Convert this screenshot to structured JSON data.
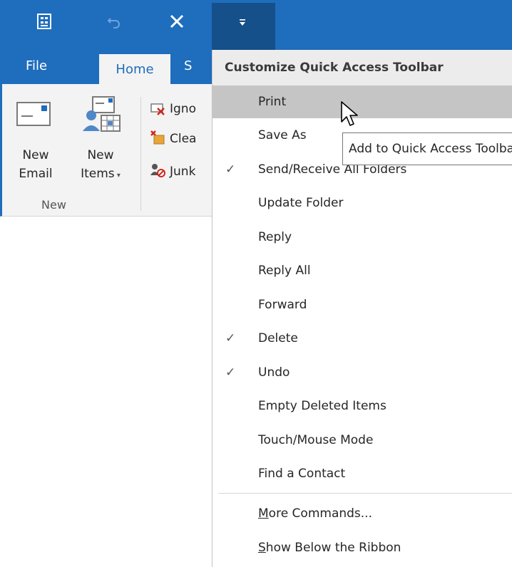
{
  "qat": {
    "buttons": [
      {
        "name": "send-receive-all-icon"
      },
      {
        "name": "undo-icon"
      },
      {
        "name": "delete-icon"
      },
      {
        "name": "customize-qat-dropdown-icon"
      }
    ]
  },
  "tabs": {
    "file": "File",
    "home": "Home",
    "next_partial": "S"
  },
  "ribbon": {
    "new_email": [
      "New",
      "Email"
    ],
    "new_items": [
      "New",
      "Items"
    ],
    "group_label": "New",
    "small_buttons": [
      {
        "label": "Igno",
        "icon": "ignore-icon"
      },
      {
        "label": "Clea",
        "icon": "clean-up-icon"
      },
      {
        "label": "Junk",
        "icon": "junk-icon"
      }
    ]
  },
  "menu": {
    "header": "Customize Quick Access Toolbar",
    "items": [
      {
        "label": "Print",
        "checked": false,
        "hover": true
      },
      {
        "label": "Save As",
        "checked": false
      },
      {
        "label": "Send/Receive All Folders",
        "checked": true
      },
      {
        "label": "Update Folder",
        "checked": false
      },
      {
        "label": "Reply",
        "checked": false
      },
      {
        "label": "Reply All",
        "checked": false
      },
      {
        "label": "Forward",
        "checked": false
      },
      {
        "label": "Delete",
        "checked": true
      },
      {
        "label": "Undo",
        "checked": true
      },
      {
        "label": "Empty Deleted Items",
        "checked": false
      },
      {
        "label": "Touch/Mouse Mode",
        "checked": false
      },
      {
        "label": "Find a Contact",
        "checked": false
      }
    ],
    "more_commands": "More Commands...",
    "more_commands_accel": "M",
    "more_commands_rest": "ore Commands...",
    "show_below": "Show Below the Ribbon",
    "show_below_accel": "S",
    "show_below_rest": "how Below the Ribbon"
  },
  "tooltip": "Add to Quick Access Toolbar",
  "check_glyph": "✓",
  "colors": {
    "accent": "#1f6dbd",
    "accent_dark": "#15508a",
    "hover": "#c5c5c5"
  }
}
